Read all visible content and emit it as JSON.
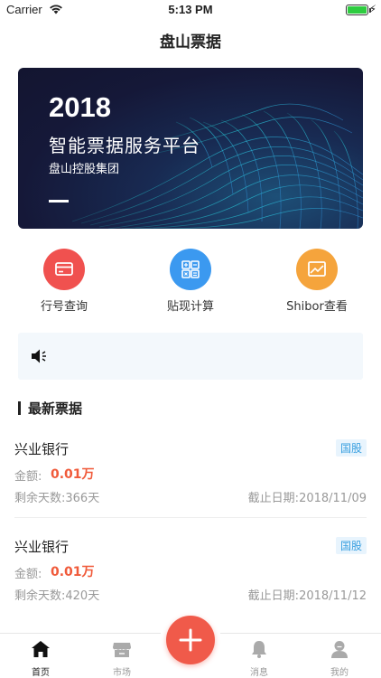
{
  "status_bar": {
    "carrier": "Carrier",
    "time": "5:13 PM",
    "battery_level": 1.0
  },
  "nav": {
    "title": "盘山票据"
  },
  "banner": {
    "year": "2018",
    "title": "智能票据服务平台",
    "subtitle": "盘山控股集团"
  },
  "quick_actions": [
    {
      "label": "行号查询",
      "icon": "card-icon",
      "color": "#f0514f"
    },
    {
      "label": "贴现计算",
      "icon": "calculator-icon",
      "color": "#3b99f0"
    },
    {
      "label": "Shibor查看",
      "icon": "chart-image-icon",
      "color": "#f5a43c"
    }
  ],
  "notice": {
    "icon": "speaker-icon"
  },
  "section": {
    "title": "最新票据"
  },
  "bills": [
    {
      "bank": "兴业银行",
      "tag": "国股",
      "amount_label": "金额:",
      "amount_value": "0.01万",
      "days_label": "剩余天数:",
      "days_value": "366天",
      "deadline_label": "截止日期:",
      "deadline_value": "2018/11/09"
    },
    {
      "bank": "兴业银行",
      "tag": "国股",
      "amount_label": "金额:",
      "amount_value": "0.01万",
      "days_label": "剩余天数:",
      "days_value": "420天",
      "deadline_label": "截止日期:",
      "deadline_value": "2018/11/12"
    }
  ],
  "tabbar": {
    "items": [
      {
        "label": "首页",
        "icon": "home-icon",
        "active": true
      },
      {
        "label": "市场",
        "icon": "store-icon",
        "active": false
      },
      {
        "label": "消息",
        "icon": "bell-icon",
        "active": false
      },
      {
        "label": "我的",
        "icon": "user-icon",
        "active": false
      }
    ],
    "fab_icon": "plus-icon",
    "fab_color": "#f05a4a"
  },
  "colors": {
    "accent_red": "#f05a3a",
    "tag_blue": "#3aa0e0"
  }
}
